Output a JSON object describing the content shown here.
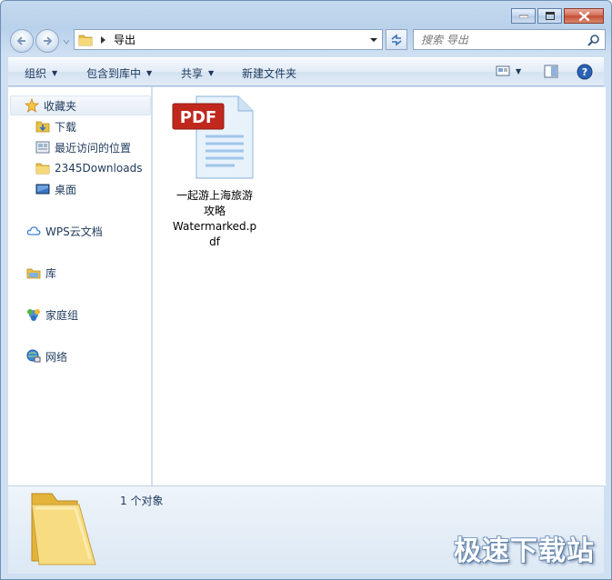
{
  "window": {
    "caption_buttons": [
      "minimize",
      "maximize",
      "close"
    ]
  },
  "address": {
    "path": "导出",
    "back_icon": "arrow-left-icon",
    "forward_icon": "arrow-right-icon"
  },
  "search": {
    "placeholder": "搜索 导出"
  },
  "toolbar": {
    "organize": "组织",
    "include_in_library": "包含到库中",
    "share": "共享",
    "new_folder": "新建文件夹"
  },
  "sidebar": {
    "favorites": {
      "label": "收藏夹",
      "items": [
        {
          "label": "下载",
          "icon": "download-folder-icon"
        },
        {
          "label": "最近访问的位置",
          "icon": "recent-places-icon"
        },
        {
          "label": "2345Downloads",
          "icon": "folder-icon"
        },
        {
          "label": "桌面",
          "icon": "desktop-icon"
        }
      ]
    },
    "wps_cloud": "WPS云文档",
    "libraries": "库",
    "homegroup": "家庭组",
    "network": "网络"
  },
  "files": [
    {
      "name": "一起游上海旅游攻略Watermarked.pdf",
      "name_lines": [
        "一起游上海旅游",
        "攻略",
        "Watermarked.p",
        "df"
      ],
      "badge": "PDF",
      "icon": "pdf-file-icon"
    }
  ],
  "status": {
    "count_text": "1 个对象"
  },
  "watermark": "极速下载站",
  "colors": {
    "pdf_red": "#c0281e",
    "window_frame": "#b9d1ea"
  }
}
